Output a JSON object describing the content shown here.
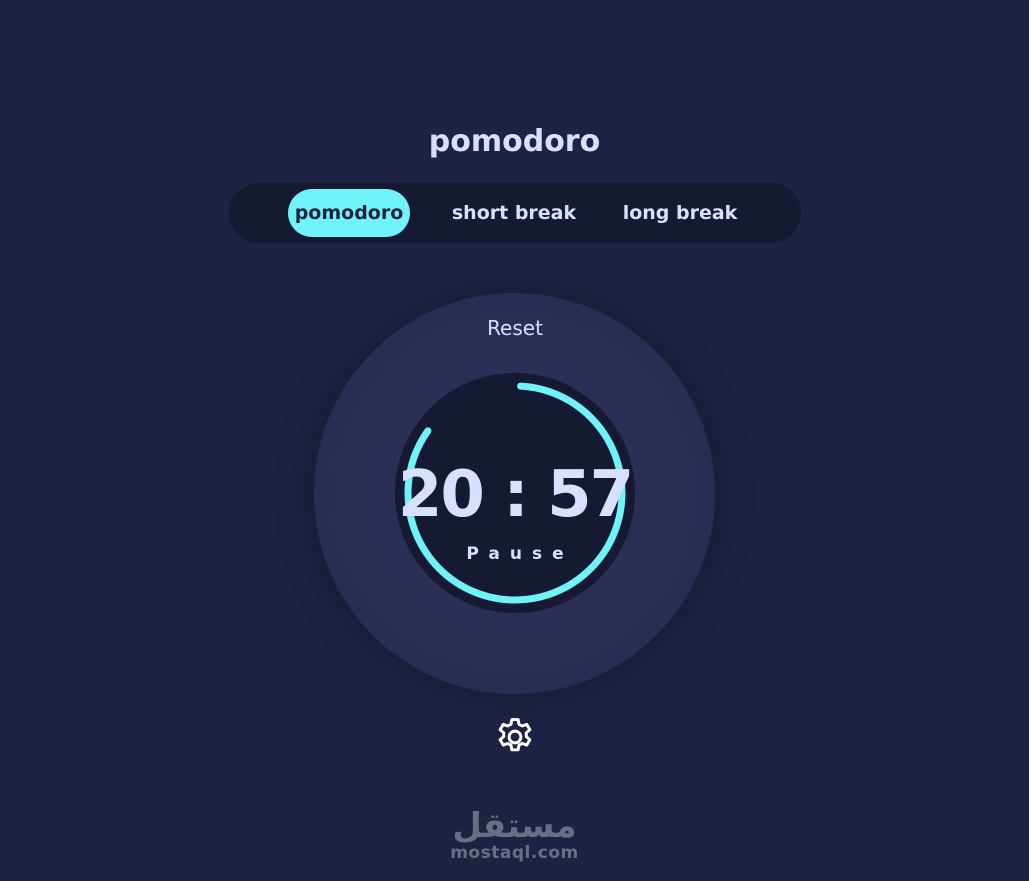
{
  "app": {
    "title": "pomodoro"
  },
  "modes": [
    {
      "label": "pomodoro",
      "active": true
    },
    {
      "label": "short break",
      "active": false
    },
    {
      "label": "long break",
      "active": false
    }
  ],
  "timer": {
    "reset_label": "Reset",
    "time": "20 : 57",
    "action_label": "Pause",
    "progress": 0.84
  },
  "settings": {
    "icon": "gear-icon"
  },
  "watermark": {
    "logo": "مستقل",
    "url": "mostaql.com"
  },
  "colors": {
    "background": "#1f2242",
    "panel": "#161932",
    "accent": "#70f3f8",
    "text": "#d7e0ff"
  }
}
